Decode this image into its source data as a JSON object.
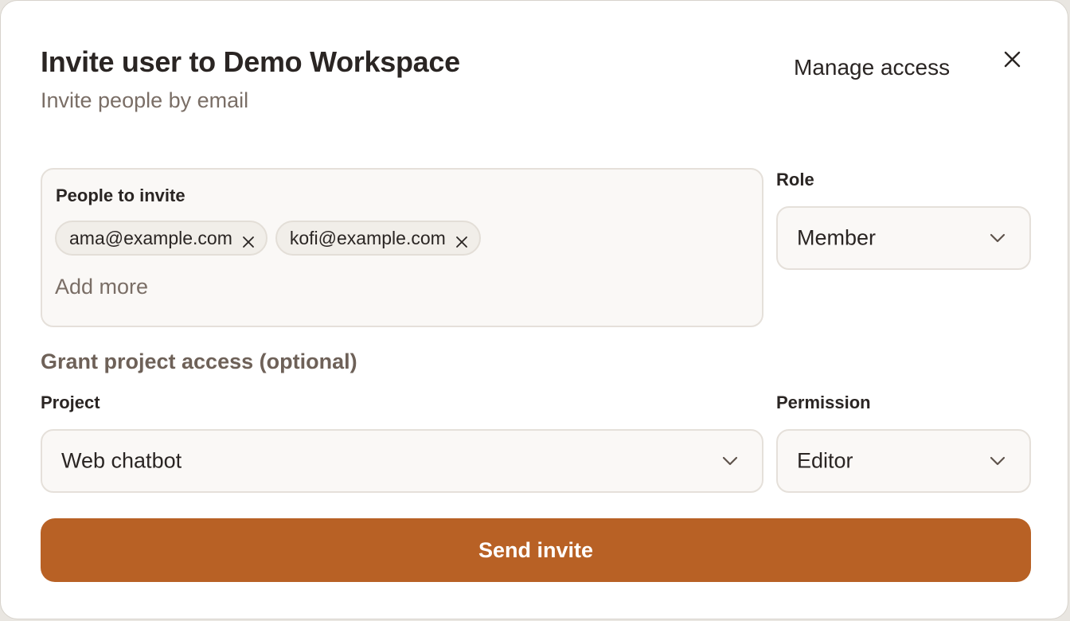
{
  "dialog": {
    "title": "Invite user to Demo Workspace",
    "subtitle": "Invite people by email",
    "manage_access_label": "Manage access",
    "close_icon": "close-icon"
  },
  "people": {
    "label": "People to invite",
    "chips": [
      {
        "email": "ama@example.com",
        "remove_icon": "close-icon"
      },
      {
        "email": "kofi@example.com",
        "remove_icon": "close-icon"
      }
    ],
    "add_placeholder": "Add more"
  },
  "role": {
    "label": "Role",
    "value": "Member",
    "icon": "chevron-down-icon"
  },
  "project_access": {
    "heading": "Grant project access (optional)",
    "project_label": "Project",
    "project_value": "Web chatbot",
    "permission_label": "Permission",
    "permission_value": "Editor"
  },
  "actions": {
    "send_label": "Send invite"
  },
  "colors": {
    "accent": "#b86125",
    "text": "#2a2523",
    "muted": "#7a6e66",
    "field_bg": "#faf8f6",
    "border": "#e5e0da"
  }
}
